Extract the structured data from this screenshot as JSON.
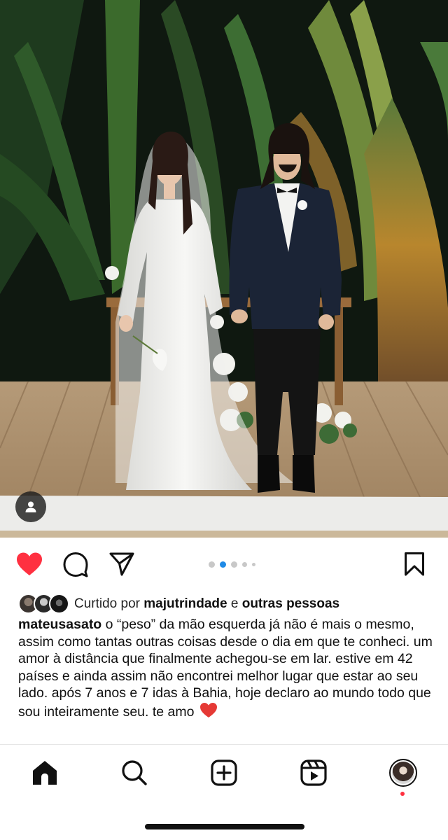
{
  "post": {
    "image_alt": "wedding photo",
    "carousel": {
      "count": 5,
      "active_index": 1
    },
    "liked": true
  },
  "likes": {
    "prefix": "Curtido por ",
    "user": "majutrindade",
    "conjunction": " e ",
    "others": "outras pessoas"
  },
  "caption": {
    "username": "mateusasato",
    "text": " o “peso” da mão esquerda já não é mais o mesmo, assim como tantas outras coisas desde o dia em que te conheci. um amor à distância que finalmente achegou-se em lar. estive em 42 países e ainda assim não encontrei melhor lugar que estar ao seu lado. após 7 anos e 7 idas à Bahia, hoje declaro ao mundo todo que sou inteiramente seu. te amo"
  },
  "nav": {
    "items": [
      "home",
      "search",
      "create",
      "reels",
      "profile"
    ],
    "profile_has_notification": true
  },
  "colors": {
    "like_red": "#ff3040",
    "carousel_active": "#1f8ae6",
    "carousel_inactive": "#c8c8c8"
  }
}
